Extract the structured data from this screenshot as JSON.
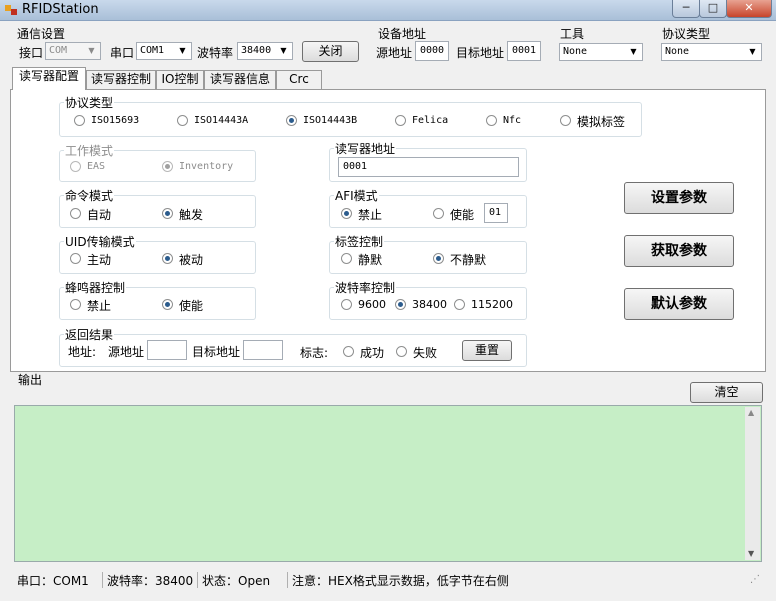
{
  "window": {
    "title": "RFIDStation",
    "min_glyph": "─",
    "max_glyph": "□",
    "close_glyph": "✕"
  },
  "comm": {
    "group_title": "通信设置",
    "port_label": "接口",
    "port_value": "COM",
    "serial_label": "串口",
    "serial_value": "COM1",
    "baud_label": "波特率",
    "baud_value": "38400",
    "close_button": "关闭"
  },
  "device_addr": {
    "group_title": "设备地址",
    "src_label": "源地址",
    "src_value": "0000",
    "dst_label": "目标地址",
    "dst_value": "0001"
  },
  "tools": {
    "group_title": "工具",
    "value": "None"
  },
  "protocol_top": {
    "group_title": "协议类型",
    "value": "None"
  },
  "tabs": [
    "读写器配置",
    "读写器控制",
    "IO控制",
    "读写器信息",
    "Crc"
  ],
  "config": {
    "protocol": {
      "title": "协议类型",
      "options": [
        "ISO15693",
        "ISO14443A",
        "ISO14443B",
        "Felica",
        "Nfc",
        "模拟标签"
      ],
      "selected": 2
    },
    "work_mode": {
      "title": "工作模式",
      "options": [
        "EAS",
        "Inventory"
      ],
      "selected": 1
    },
    "reader_addr": {
      "title": "读写器地址",
      "value": "0001"
    },
    "cmd_mode": {
      "title": "命令模式",
      "options": [
        "自动",
        "触发"
      ],
      "selected": 1
    },
    "afi_mode": {
      "title": "AFI模式",
      "options": [
        "禁止",
        "使能"
      ],
      "selected": 0,
      "value": "01"
    },
    "uid_mode": {
      "title": "UID传输模式",
      "options": [
        "主动",
        "被动"
      ],
      "selected": 1
    },
    "tag_ctrl": {
      "title": "标签控制",
      "options": [
        "静默",
        "不静默"
      ],
      "selected": 1
    },
    "buzzer": {
      "title": "蜂鸣器控制",
      "options": [
        "禁止",
        "使能"
      ],
      "selected": 1
    },
    "baud_ctrl": {
      "title": "波特率控制",
      "options": [
        "9600",
        "38400",
        "115200"
      ],
      "selected": 1
    },
    "result": {
      "title": "返回结果",
      "addr_label": "地址:",
      "src_label": "源地址",
      "dst_label": "目标地址",
      "flag_label": "标志:",
      "options": [
        "成功",
        "失败"
      ],
      "reset_button": "重置"
    },
    "buttons": {
      "set": "设置参数",
      "get": "获取参数",
      "default": "默认参数"
    }
  },
  "output": {
    "label": "输出",
    "clear_button": "清空"
  },
  "status": {
    "port": "串口：COM1",
    "baud": "波特率：38400",
    "state": "状态：Open",
    "note": "注意：HEX格式显示数据，低字节在右侧"
  },
  "colors": {
    "output_bg": "#c6eec6",
    "accent": "#2c5c8d"
  }
}
